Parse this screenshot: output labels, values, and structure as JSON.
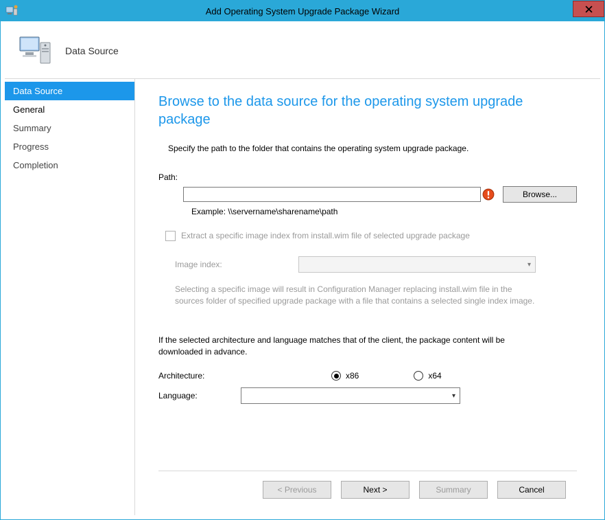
{
  "window": {
    "title": "Add Operating System Upgrade Package Wizard"
  },
  "header": {
    "title": "Data Source"
  },
  "sidebar": {
    "items": [
      {
        "label": "Data Source",
        "active": true
      },
      {
        "label": "General",
        "active": false
      },
      {
        "label": "Summary",
        "active": false
      },
      {
        "label": "Progress",
        "active": false
      },
      {
        "label": "Completion",
        "active": false
      }
    ]
  },
  "content": {
    "heading": "Browse to the data source for the operating system upgrade package",
    "instruction": "Specify the path to the folder that contains the operating system upgrade package.",
    "path_label": "Path:",
    "path_value": "",
    "browse_label": "Browse...",
    "example_label": "Example: \\\\servername\\sharename\\path",
    "extract_label": "Extract a specific image index from install.wim file of selected upgrade package",
    "index_label": "Image index:",
    "index_help": "Selecting a specific image will result in Configuration Manager replacing install.wim file in the sources folder of specified upgrade package with a file that contains a selected single index image.",
    "arch_note": "If the selected architecture and language matches that of the client, the package content will be downloaded in advance.",
    "arch_label": "Architecture:",
    "arch_options": {
      "x86": "x86",
      "x64": "x64"
    },
    "arch_selected": "x86",
    "lang_label": "Language:"
  },
  "buttons": {
    "previous": "< Previous",
    "next": "Next >",
    "summary": "Summary",
    "cancel": "Cancel"
  }
}
